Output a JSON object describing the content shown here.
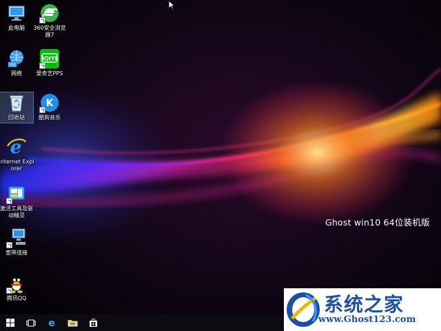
{
  "desktop": {
    "icons": [
      {
        "id": "this-pc",
        "label": "此电脑"
      },
      {
        "id": "360-browser",
        "label": "360安全浏览器7"
      },
      {
        "id": "network",
        "label": "网络"
      },
      {
        "id": "iqiyi",
        "label": "爱奇艺PPS"
      },
      {
        "id": "recycle-bin",
        "label": "回收站"
      },
      {
        "id": "kuwo-music",
        "label": "酷狗音乐"
      },
      {
        "id": "internet-explorer",
        "label": "Internet Explorer"
      },
      {
        "id": "activation-tool",
        "label": "激活工具及驱动精灵"
      },
      {
        "id": "broadband",
        "label": "宽带连接"
      },
      {
        "id": "tencent-qq",
        "label": "腾讯QQ"
      }
    ]
  },
  "wallpaper": {
    "caption": "Ghost  win10  64位装机版"
  },
  "watermark": {
    "title": "系统之家",
    "url": "www.Ghost123.com"
  },
  "taskbar": {
    "items": [
      "start",
      "task-view",
      "edge",
      "file-explorer",
      "store"
    ]
  },
  "colors": {
    "brand_blue": "#1d4fa8",
    "taskbar": "#0b0b12"
  }
}
